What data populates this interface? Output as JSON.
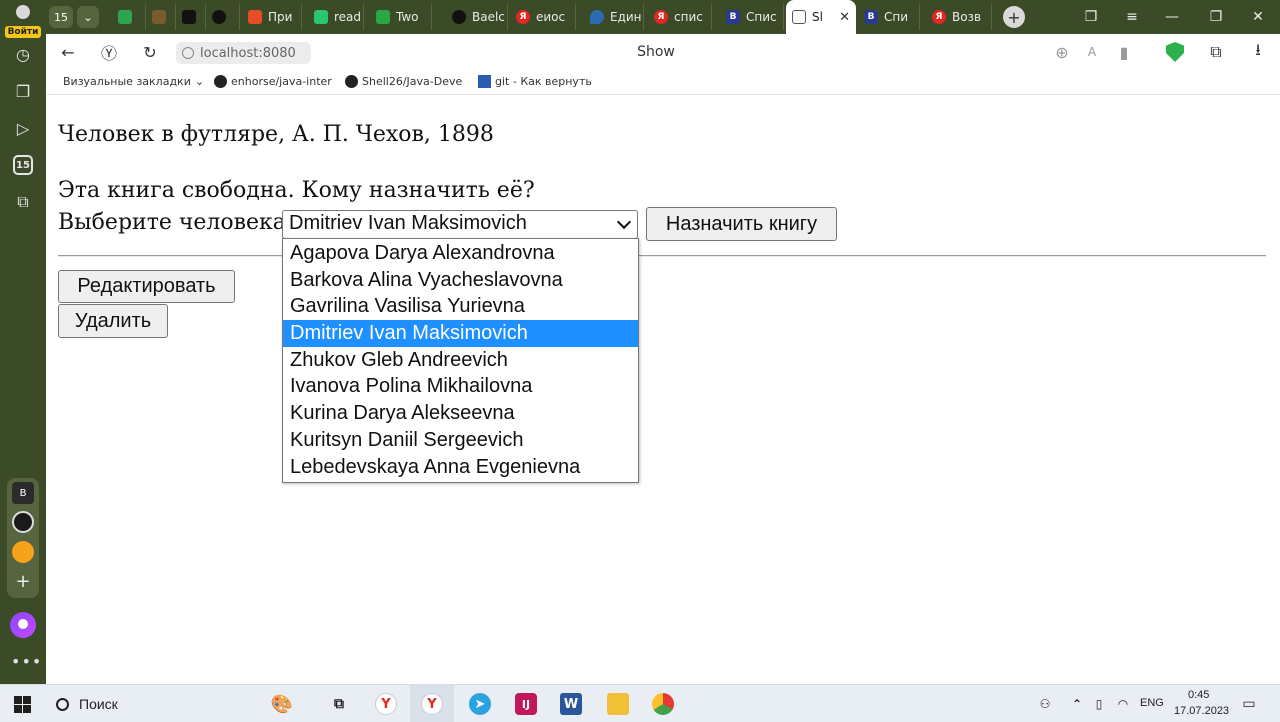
{
  "sidebar": {
    "login_label": "Войти",
    "badge_count": "15",
    "group_letter": "B"
  },
  "tabs": {
    "counter": "15",
    "items": [
      {
        "label": "",
        "color": "#2da44e"
      },
      {
        "label": "",
        "color": "#7a5c2e"
      },
      {
        "label": "",
        "color": "#111111"
      },
      {
        "label": "",
        "color": "#111111"
      },
      {
        "label": "При",
        "color": "#e44d26"
      },
      {
        "label": "read",
        "color": "#28c76f"
      },
      {
        "label": "Two",
        "color": "#28a745"
      },
      {
        "label": "Baelc",
        "color": "#111111"
      },
      {
        "label": "еиос",
        "color": "#e52620"
      },
      {
        "label": "Един",
        "color": "#2b6cb0"
      },
      {
        "label": "спис",
        "color": "#e52620"
      },
      {
        "label": "Спис",
        "color": "#2b3a8c"
      },
      {
        "label": "Sl",
        "color": "#ffffff"
      },
      {
        "label": "Спи",
        "color": "#2b3a8c"
      },
      {
        "label": "Возв",
        "color": "#e52620"
      }
    ]
  },
  "toolbar": {
    "url": "localhost:8080",
    "page_title": "Show"
  },
  "bookmarks": [
    {
      "label": "Визуальные закладки",
      "icon": "chevron-down-icon"
    },
    {
      "label": "enhorse/java-inter",
      "icon": "github-icon"
    },
    {
      "label": "Shell26/Java-Deve",
      "icon": "github-icon"
    },
    {
      "label": "git - Как вернуть",
      "icon": "git-icon"
    }
  ],
  "page": {
    "book_title": "Человек в футляре, А. П. Чехов, 1898",
    "free_text": "Эта книга свободна. Кому назначить её?",
    "choose_label": "Выберите человека",
    "selected_person": "Dmitriev Ivan Maksimovich",
    "assign_button": "Назначить книгу",
    "edit_button": "Редактировать",
    "delete_button": "Удалить",
    "options": [
      "Agapova Darya Alexandrovna",
      "Barkova Alina Vyacheslavovna",
      "Gavrilina Vasilisa Yurievna",
      "Dmitriev Ivan Maksimovich",
      "Zhukov Gleb Andreevich",
      "Ivanova Polina Mikhailovna",
      "Kurina Darya Alekseevna",
      "Kuritsyn Daniil Sergeevich",
      "Lebedevskaya Anna Evgenievna"
    ]
  },
  "taskbar": {
    "search_placeholder": "Поиск",
    "lang": "ENG",
    "time": "0:45",
    "date": "17.07.2023"
  },
  "colors": {
    "sidebar_bg": "#3b4a27",
    "selected_option": "#1e90ff",
    "shield": "#2bb24c"
  }
}
